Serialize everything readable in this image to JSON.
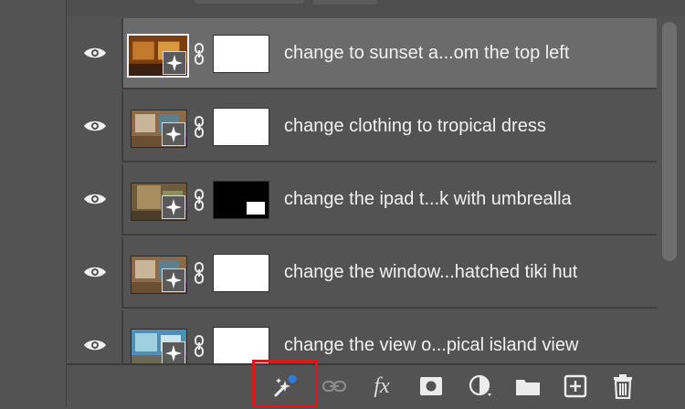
{
  "layers": [
    {
      "name": "change to sunset a...om the top left",
      "mask": "white",
      "selected": true,
      "thumb_colors": [
        "#7a3e10",
        "#c47a2c",
        "#3a2010"
      ]
    },
    {
      "name": "change clothing to tropical dress",
      "mask": "white",
      "selected": false,
      "thumb_colors": [
        "#8a6a48",
        "#c9b69a",
        "#5b7f8c"
      ]
    },
    {
      "name": "change the ipad t...k with umbrealla",
      "mask": "black",
      "selected": false,
      "thumb_colors": [
        "#6f5a3c",
        "#a88e5e",
        "#8a9260"
      ]
    },
    {
      "name": "change the window...hatched tiki hut",
      "mask": "white",
      "selected": false,
      "thumb_colors": [
        "#8a6a48",
        "#c9b69a",
        "#5b7f8c"
      ]
    },
    {
      "name": "change the view o...pical island view",
      "mask": "white",
      "selected": false,
      "thumb_colors": [
        "#4f8fb5",
        "#9fd0e0",
        "#6b6a52"
      ]
    }
  ],
  "toolbar": {
    "fx_label": "fx",
    "tools": [
      "generative-fill-icon",
      "link-icon",
      "fx-icon",
      "mask-icon",
      "adjustment-icon",
      "folder-icon",
      "new-layer-icon",
      "trash-icon"
    ]
  },
  "colors": {
    "panel": "#535353",
    "selected_row": "#6b6b6b",
    "highlight_border": "#e0161b",
    "badge_dot": "#2f7de1"
  }
}
